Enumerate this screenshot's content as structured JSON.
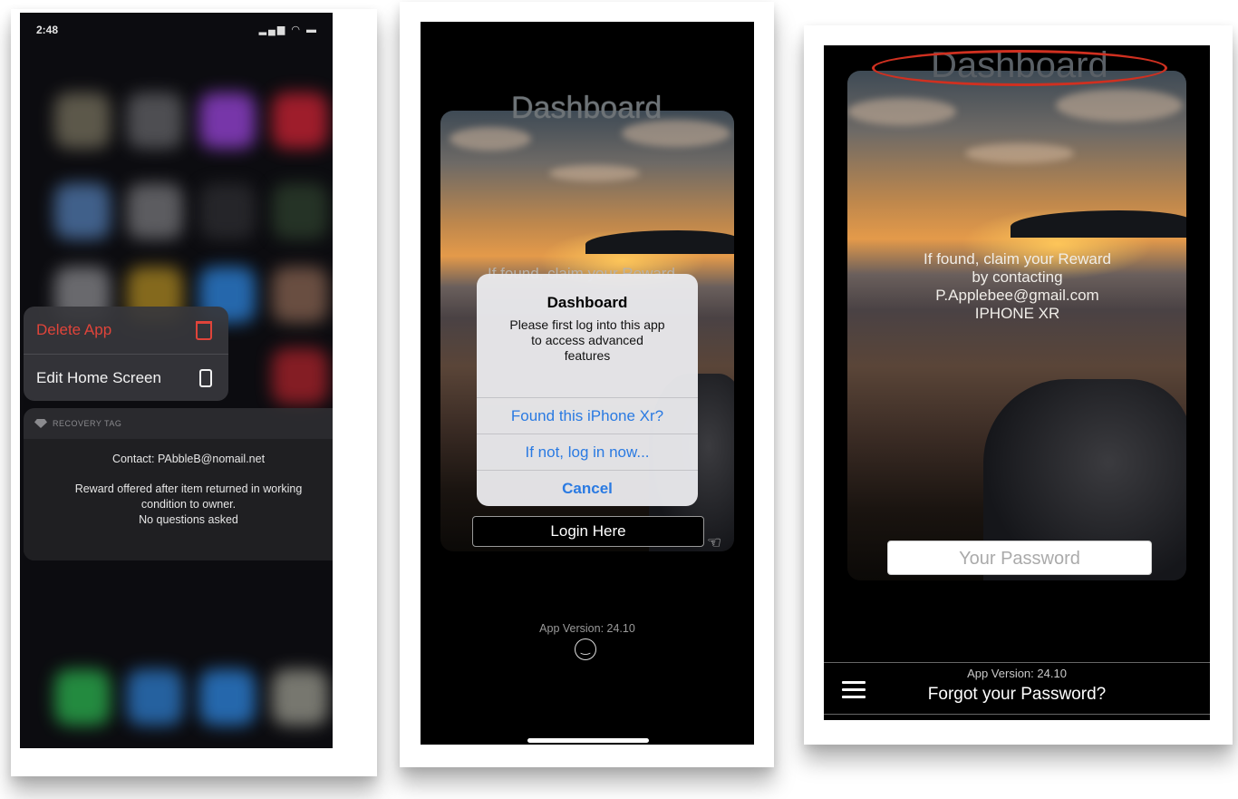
{
  "panel1": {
    "status_time": "2:48",
    "status_icons": "signal wifi battery",
    "context_menu": {
      "delete_label": "Delete App",
      "edit_label": "Edit Home Screen",
      "delete_icon": "trash-icon",
      "edit_icon": "phone-screen-icon"
    },
    "widget": {
      "header": "RECOVERY TAG",
      "contact": "Contact: PAbbleB@nomail.net",
      "line1": "Reward offered after item returned in working",
      "line2": "condition to owner.",
      "line3": "No questions asked"
    },
    "colors": {
      "delete": "#e0443a"
    }
  },
  "panel2": {
    "title": "Dashboard",
    "background_text": "If found, claim your Reward",
    "alert": {
      "title": "Dashboard",
      "message_line1": "Please first log into this app",
      "message_line2": "to access advanced",
      "message_line3": "features",
      "button1": "Found this iPhone Xr?",
      "button2": "If not, log in now...",
      "button3": "Cancel"
    },
    "login_button": "Login Here",
    "version": "App Version: 24.10",
    "colors": {
      "alert_button": "#2a7ae2"
    }
  },
  "panel3": {
    "title": "Dashboard",
    "found_line1": "If found, claim your Reward",
    "found_line2": "by contacting",
    "found_line3": "P.Applebee@gmail.com",
    "found_line4": "IPHONE XR",
    "password_placeholder": "Your Password",
    "version": "App Version: 24.10",
    "forgot_link": "Forgot your Password?",
    "colors": {
      "highlight_oval": "#d03020"
    }
  }
}
